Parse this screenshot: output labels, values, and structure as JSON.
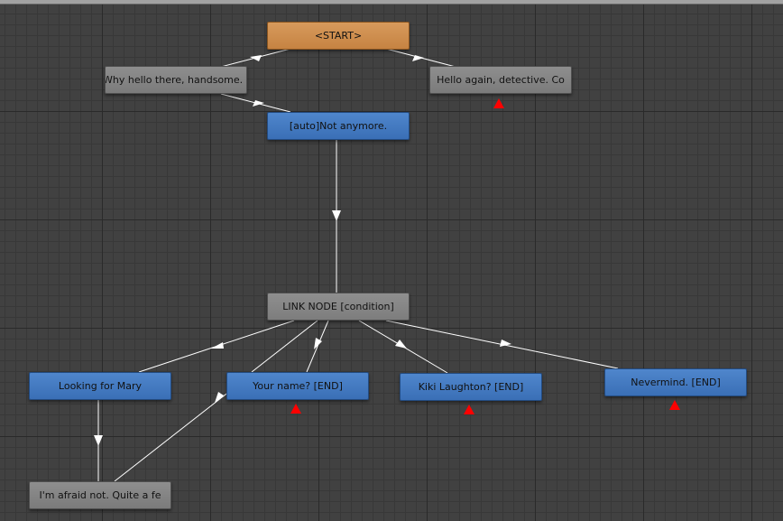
{
  "graph": {
    "nodes": {
      "start": "<START>",
      "why_hello": "Why hello there, handsome.",
      "hello_again": "Hello again, detective. Co",
      "not_anymore": "[auto]Not anymore.",
      "link_node": "LINK NODE [condition]",
      "looking_for_mary": "Looking for Mary",
      "your_name": "Your name? [END]",
      "kiki_laughton": "Kiki Laughton? [END]",
      "nevermind": "Nevermind. [END]",
      "afraid_not": "I'm afraid not. Quite a fe"
    },
    "warning_icon": "red-triangle-warning",
    "colors": {
      "start_node": "#c98a4b",
      "npc_node": "#858585",
      "player_node": "#4679c0",
      "edge": "#ffffff",
      "warning": "#ff0000",
      "canvas": "#414141"
    }
  }
}
